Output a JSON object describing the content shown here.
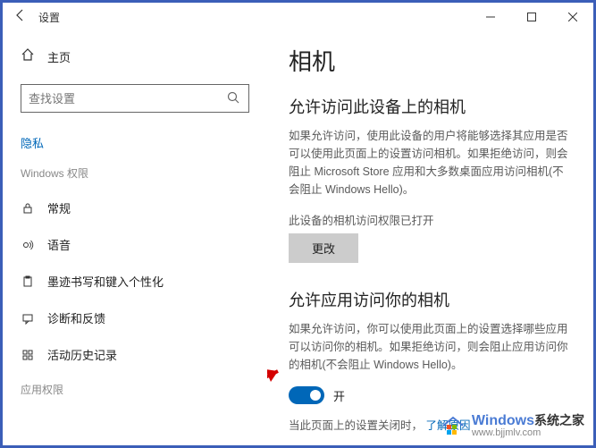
{
  "window": {
    "title": "设置"
  },
  "sidebar": {
    "home": "主页",
    "search_placeholder": "查找设置",
    "section": "隐私",
    "group": "Windows 权限",
    "items": [
      {
        "label": "常规"
      },
      {
        "label": "语音"
      },
      {
        "label": "墨迹书写和键入个性化"
      },
      {
        "label": "诊断和反馈"
      },
      {
        "label": "活动历史记录"
      }
    ],
    "truncated": "应用权限"
  },
  "main": {
    "title": "相机",
    "section1_title": "允许访问此设备上的相机",
    "section1_desc": "如果允许访问，使用此设备的用户将能够选择其应用是否可以使用此页面上的设置访问相机。如果拒绝访问，则会阻止 Microsoft Store 应用和大多数桌面应用访问相机(不会阻止 Windows Hello)。",
    "device_status": "此设备的相机访问权限已打开",
    "change_button": "更改",
    "section2_title": "允许应用访问你的相机",
    "section2_desc": "如果允许访问，你可以使用此页面上的设置选择哪些应用可以访问你的相机。如果拒绝访问，则会阻止应用访问你的相机(不会阻止 Windows Hello)。",
    "toggle_state": "开",
    "footer_text": "当此页面上的设置关闭时，",
    "footer_link": "了解原因"
  },
  "watermark": {
    "brand": "Windows",
    "sub": "系统之家",
    "url": "www.bjjmlv.com"
  }
}
